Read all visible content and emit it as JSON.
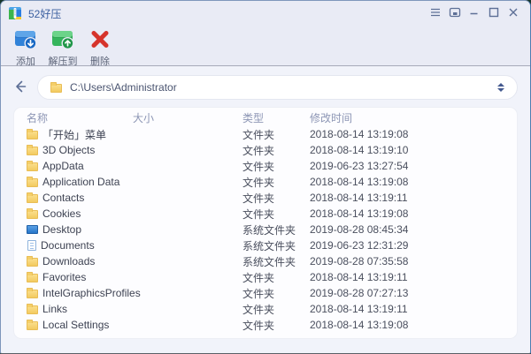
{
  "window": {
    "title": "52好压",
    "controls": [
      {
        "name": "menu-icon"
      },
      {
        "name": "boss-window-icon"
      },
      {
        "name": "minimize-icon"
      },
      {
        "name": "maximize-icon"
      },
      {
        "name": "close-icon"
      }
    ]
  },
  "toolbar": {
    "items": [
      {
        "label": "添加",
        "icon": "add-archive-icon"
      },
      {
        "label": "解压到",
        "icon": "extract-to-icon"
      },
      {
        "label": "删除",
        "icon": "delete-icon"
      }
    ]
  },
  "addressbar": {
    "back_icon": "back-arrow-icon",
    "folder_icon": "folder-icon",
    "path": "C:\\Users\\Administrator",
    "spinner_icon": "updown-spinner-icon"
  },
  "files": {
    "columns": [
      "名称",
      "大小",
      "类型",
      "修改时间"
    ],
    "rows": [
      {
        "icon": "folder-icon",
        "name": "「开始」菜单",
        "size": "",
        "type": "文件夹",
        "modified": "2018-08-14 13:19:08"
      },
      {
        "icon": "folder-icon",
        "name": "3D Objects",
        "size": "",
        "type": "文件夹",
        "modified": "2018-08-14 13:19:10"
      },
      {
        "icon": "folder-icon",
        "name": "AppData",
        "size": "",
        "type": "文件夹",
        "modified": "2019-06-23 13:27:54"
      },
      {
        "icon": "folder-icon",
        "name": "Application Data",
        "size": "",
        "type": "文件夹",
        "modified": "2018-08-14 13:19:08"
      },
      {
        "icon": "folder-icon",
        "name": "Contacts",
        "size": "",
        "type": "文件夹",
        "modified": "2018-08-14 13:19:11"
      },
      {
        "icon": "folder-icon",
        "name": "Cookies",
        "size": "",
        "type": "文件夹",
        "modified": "2018-08-14 13:19:08"
      },
      {
        "icon": "desktop-icon",
        "name": "Desktop",
        "size": "",
        "type": "系统文件夹",
        "modified": "2019-08-28 08:45:34"
      },
      {
        "icon": "document-icon",
        "name": "Documents",
        "size": "",
        "type": "系统文件夹",
        "modified": "2019-06-23 12:31:29"
      },
      {
        "icon": "folder-icon",
        "name": "Downloads",
        "size": "",
        "type": "系统文件夹",
        "modified": "2019-08-28 07:35:58"
      },
      {
        "icon": "folder-icon",
        "name": "Favorites",
        "size": "",
        "type": "文件夹",
        "modified": "2018-08-14 13:19:11"
      },
      {
        "icon": "folder-icon",
        "name": "IntelGraphicsProfiles",
        "size": "",
        "type": "文件夹",
        "modified": "2019-08-28 07:27:13"
      },
      {
        "icon": "folder-icon",
        "name": "Links",
        "size": "",
        "type": "文件夹",
        "modified": "2018-08-14 13:19:11"
      },
      {
        "icon": "folder-icon",
        "name": "Local Settings",
        "size": "",
        "type": "文件夹",
        "modified": "2018-08-14 13:19:08"
      }
    ]
  },
  "colors": {
    "titlebar_bg": "#e9ebf5",
    "content_bg": "#f1f3fa",
    "panel_bg": "#fdfdff",
    "title_text": "#3b5fa0",
    "header_text": "#8d96b5",
    "add_icon_blue": "#3182d8",
    "extract_icon_green": "#35b45c",
    "delete_icon_red": "#d6342c",
    "folder_yellow": "#f2ca60"
  }
}
